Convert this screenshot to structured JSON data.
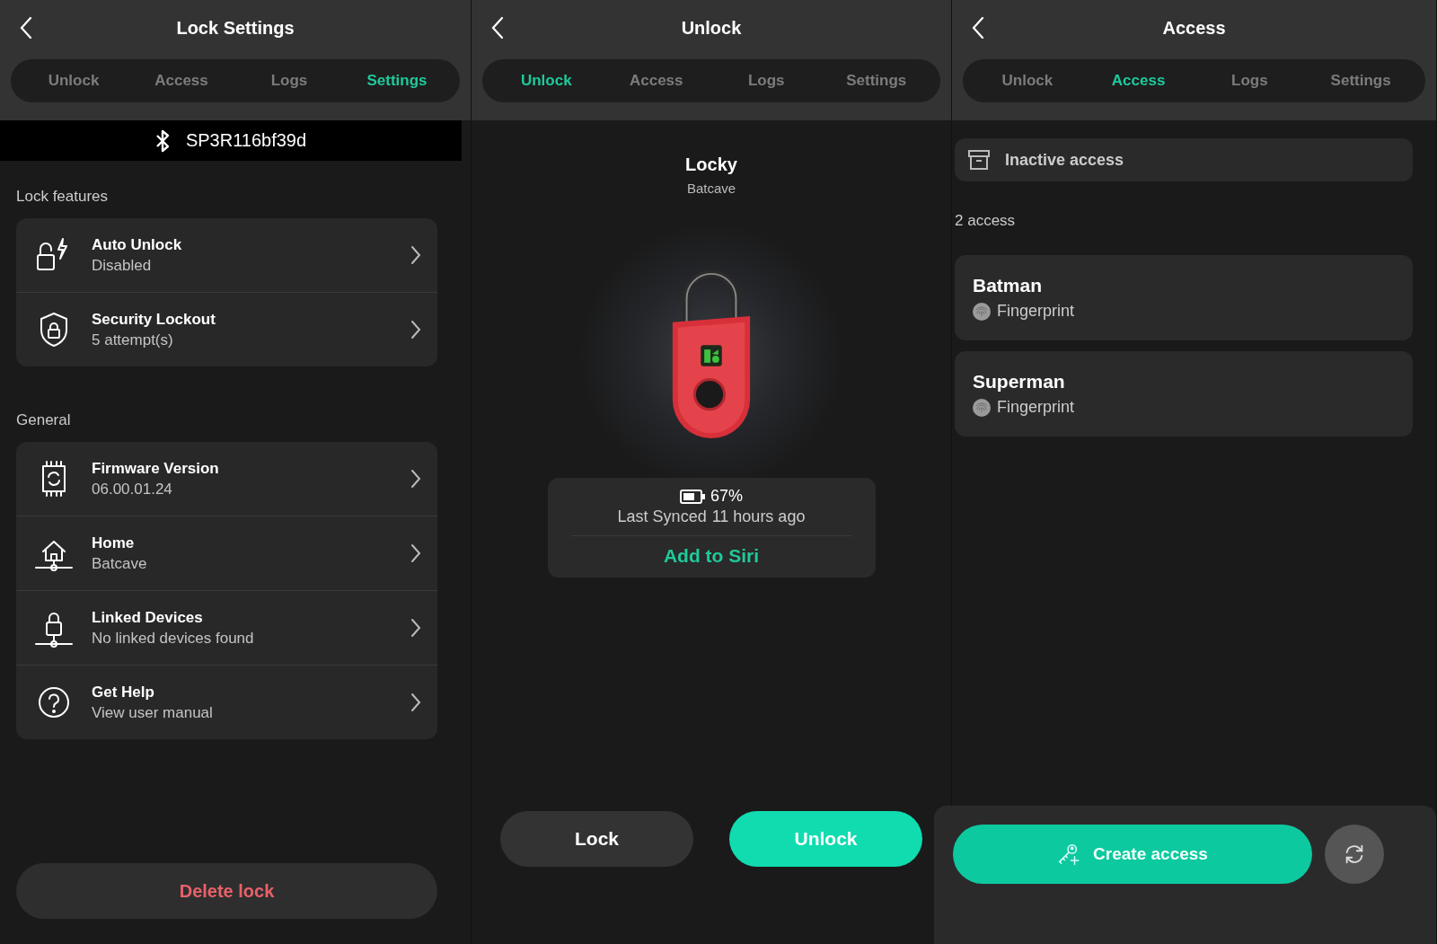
{
  "screens": [
    {
      "kind": "settings",
      "title": "Lock Settings",
      "tabs": [
        {
          "label": "Unlock",
          "selected": false
        },
        {
          "label": "Access",
          "selected": false
        },
        {
          "label": "Logs",
          "selected": false
        },
        {
          "label": "Settings",
          "selected": true
        }
      ],
      "device_bar": {
        "name": "SP3R116bf39d"
      },
      "sections": [
        {
          "heading": "Lock features",
          "items": [
            {
              "title": "Auto Unlock",
              "subtitle": "Disabled"
            },
            {
              "title": "Security Lockout",
              "subtitle": "5 attempt(s)"
            }
          ]
        },
        {
          "heading": "General",
          "items": [
            {
              "title": "Firmware Version",
              "subtitle": "06.00.01.24"
            },
            {
              "title": "Home",
              "subtitle": "Batcave"
            },
            {
              "title": "Linked Devices",
              "subtitle": "No linked devices found"
            },
            {
              "title": "Get Help",
              "subtitle": "View user manual"
            }
          ]
        }
      ],
      "delete_button": "Delete lock"
    },
    {
      "kind": "unlock",
      "title": "Unlock",
      "tabs": [
        {
          "label": "Unlock",
          "selected": true
        },
        {
          "label": "Access",
          "selected": false
        },
        {
          "label": "Logs",
          "selected": false
        },
        {
          "label": "Settings",
          "selected": false
        }
      ],
      "lock": {
        "name": "Locky",
        "location": "Batcave"
      },
      "status_card": {
        "battery": "67%",
        "synced_label": "Last Synced",
        "synced_time": "11 hours ago",
        "siri_link": "Add to Siri"
      },
      "buttons": [
        {
          "label": "Lock",
          "kind": "secondary"
        },
        {
          "label": "Unlock",
          "kind": "primary"
        }
      ]
    },
    {
      "kind": "access",
      "title": "Access",
      "tabs": [
        {
          "label": "Unlock",
          "selected": false
        },
        {
          "label": "Access",
          "selected": true
        },
        {
          "label": "Logs",
          "selected": false
        },
        {
          "label": "Settings",
          "selected": false
        }
      ],
      "inactive_button": "Inactive access",
      "count": "2 access",
      "people": [
        {
          "name": "Batman",
          "method": "Fingerprint"
        },
        {
          "name": "Superman",
          "method": "Fingerprint"
        }
      ],
      "create_button": "Create access"
    }
  ]
}
